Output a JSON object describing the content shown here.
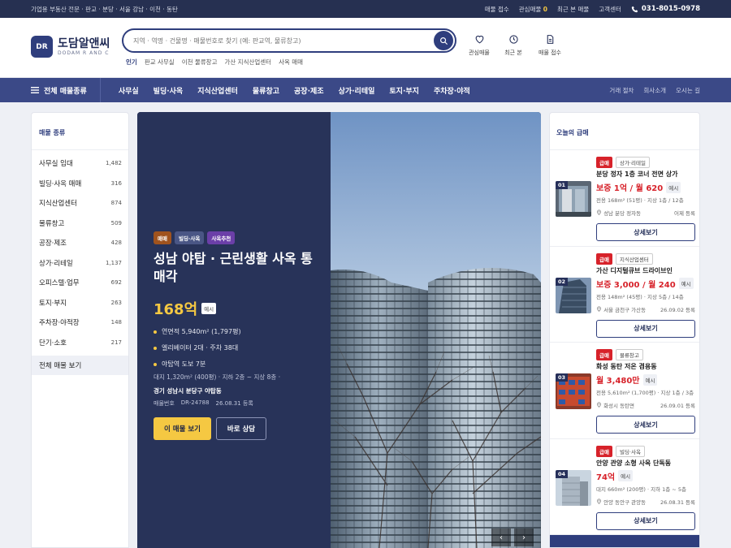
{
  "topbar": {
    "tagline": "기업용 부동산 전문 · 판교 · 분당 · 서울 강남 · 이천 · 동탄",
    "links": [
      "매물 접수",
      "관심매물",
      "최근 본 매물",
      "고객센터"
    ],
    "favorite_count": "0",
    "phone": "031-8015-0978"
  },
  "logo": {
    "mark": "DR",
    "name_ko": "도담알앤씨",
    "name_en": "DODAM R AND C"
  },
  "search": {
    "placeholder": "지역 · 역명 · 건물명 · 매물번호로 찾기 (예: 판교역, 물류창고)"
  },
  "popular": {
    "label": "인기",
    "items": [
      "판교 사무실",
      "이천 물류창고",
      "가산 지식산업센터",
      "사옥 매매"
    ]
  },
  "header_icons": [
    "관심매물",
    "최근 본",
    "매물 접수"
  ],
  "nav": {
    "all_label": "전체 매물종류",
    "items": [
      "사무실",
      "빌딩·사옥",
      "지식산업센터",
      "물류창고",
      "공장·제조",
      "상가·리테일",
      "토지·부지",
      "주차장·야적"
    ],
    "sub": [
      "거래 절차",
      "회사소개",
      "오시는 길"
    ]
  },
  "sidebar": {
    "title": "매물 종류",
    "items": [
      {
        "label": "사무실 임대",
        "count": "1,482"
      },
      {
        "label": "빌딩·사옥 매매",
        "count": "316"
      },
      {
        "label": "지식산업센터",
        "count": "874"
      },
      {
        "label": "물류창고",
        "count": "509"
      },
      {
        "label": "공장·제조",
        "count": "428"
      },
      {
        "label": "상가·리테일",
        "count": "1,137"
      },
      {
        "label": "오피스텔·업무",
        "count": "692"
      },
      {
        "label": "토지·부지",
        "count": "263"
      },
      {
        "label": "주차장·야적장",
        "count": "148"
      },
      {
        "label": "단기·소호",
        "count": "217"
      }
    ],
    "all": "전체 매물 보기"
  },
  "hero": {
    "tags": [
      "매매",
      "빌딩·사옥",
      "사옥추천"
    ],
    "tag_colors": [
      "#a0531e",
      "#4a5685",
      "#6b3fa8"
    ],
    "title": "성남 야탑 · 근린생활 사옥 통매각",
    "price": "168억",
    "price_badge": "예시",
    "bullets": [
      "연면적 5,940m² (1,797평)",
      "엘리베이터 2대 · 주차 38대",
      "야탑역 도보 7분"
    ],
    "meta": "대지 1,320m² (400평)  ·  지하 2층 ~ 지상 8층  ·",
    "address": "경기 성남시 분당구 야탑동",
    "code_label": "매물번호",
    "code": "DR-24788",
    "date": "26.08.31 등록",
    "btn_primary": "이 매물 보기",
    "btn_secondary": "바로 상담",
    "prev": "‹",
    "next": "›"
  },
  "right": {
    "title": "오늘의 급매",
    "cards": [
      {
        "num": "01",
        "urgent": "급매",
        "cat": "상가·리테일",
        "title": "분당 정자 1층 코너 전면 상가",
        "price": "보증 1억 / 월 620",
        "badge": "예시",
        "meta": "전용 168m² (51평)   ·  지상 1층 / 12층",
        "loc": "성남 분당 정자동",
        "date": "어제 등록",
        "btn": "상세보기"
      },
      {
        "num": "02",
        "urgent": "급매",
        "cat": "지식산업센터",
        "title": "가산 디지털큐브 드라이브인",
        "price": "보증 3,000 / 월 240",
        "badge": "예시",
        "meta": "전용 148m² (45평)   ·  지상 5층 / 14층",
        "loc": "서울 금천구 가산동",
        "date": "26.09.02 등록",
        "btn": "상세보기"
      },
      {
        "num": "03",
        "urgent": "급매",
        "cat": "물류창고",
        "title": "화성 동탄 저온 겸용동",
        "price": "월 3,480만",
        "badge": "예시",
        "meta": "전용 5,610m² (1,700평)  ·  지상 1층 / 3층",
        "loc": "화성시 동탄면",
        "date": "26.09.01 등록",
        "btn": "상세보기"
      },
      {
        "num": "04",
        "urgent": "급매",
        "cat": "빌딩·사옥",
        "title": "안양 관양 소형 사옥 단독동",
        "price": "74억",
        "badge": "예시",
        "meta": "대지 660m² (200평)   ·  지하 1층 ~ 5층",
        "loc": "안양 동안구 관양동",
        "date": "26.08.31 등록",
        "btn": "상세보기"
      }
    ]
  },
  "colors": {
    "navy": "#263051",
    "accent": "#2f3e7d",
    "yellow": "#f5c842",
    "urgent": "#d7222a"
  }
}
